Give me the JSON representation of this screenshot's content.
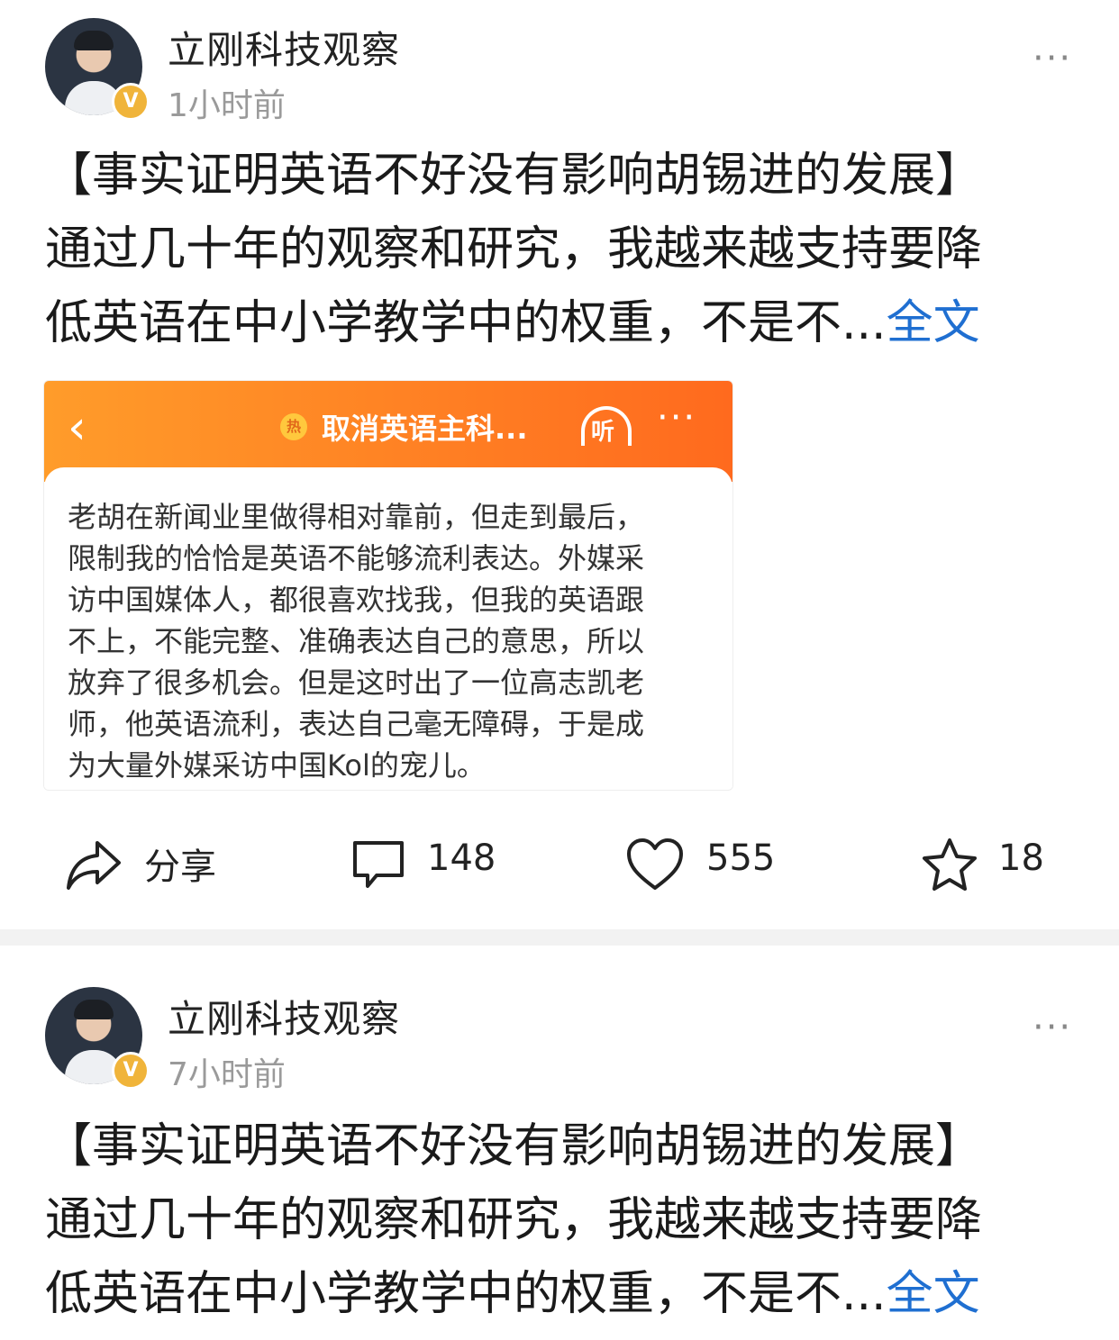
{
  "posts": [
    {
      "author": "立刚科技观察",
      "verified_badge": "V",
      "time": "1小时前",
      "more": "···",
      "lines": [
        "【事实证明英语不好没有影响胡锡进的发展】",
        "通过几十年的观察和研究，我越来越支持要降",
        "低英语在中小学教学中的权重，不是不..."
      ],
      "full_text_link": "全文",
      "image": {
        "back": "‹",
        "hot_icon": "热",
        "title": "取消英语主科...",
        "listen": "听",
        "more": "···",
        "lines": [
          "老胡在新闻业里做得相对靠前，但走到最后，",
          "限制我的恰恰是英语不能够流利表达。外媒采",
          "访中国媒体人，都很喜欢找我，但我的英语跟",
          "不上，不能完整、准确表达自己的意思，所以",
          "放弃了很多机会。但是这时出了一位高志凯老",
          "师，他英语流利，表达自己毫无障碍，于是成",
          "为大量外媒采访中国Kol的宠儿。"
        ]
      },
      "actions": {
        "share": "分享",
        "comments": "148",
        "likes": "555",
        "favorites": "18"
      }
    },
    {
      "author": "立刚科技观察",
      "verified_badge": "V",
      "time": "7小时前",
      "more": "···",
      "lines": [
        "【事实证明英语不好没有影响胡锡进的发展】",
        "通过几十年的观察和研究，我越来越支持要降",
        "低英语在中小学教学中的权重，不是不..."
      ],
      "full_text_link": "全文"
    }
  ]
}
